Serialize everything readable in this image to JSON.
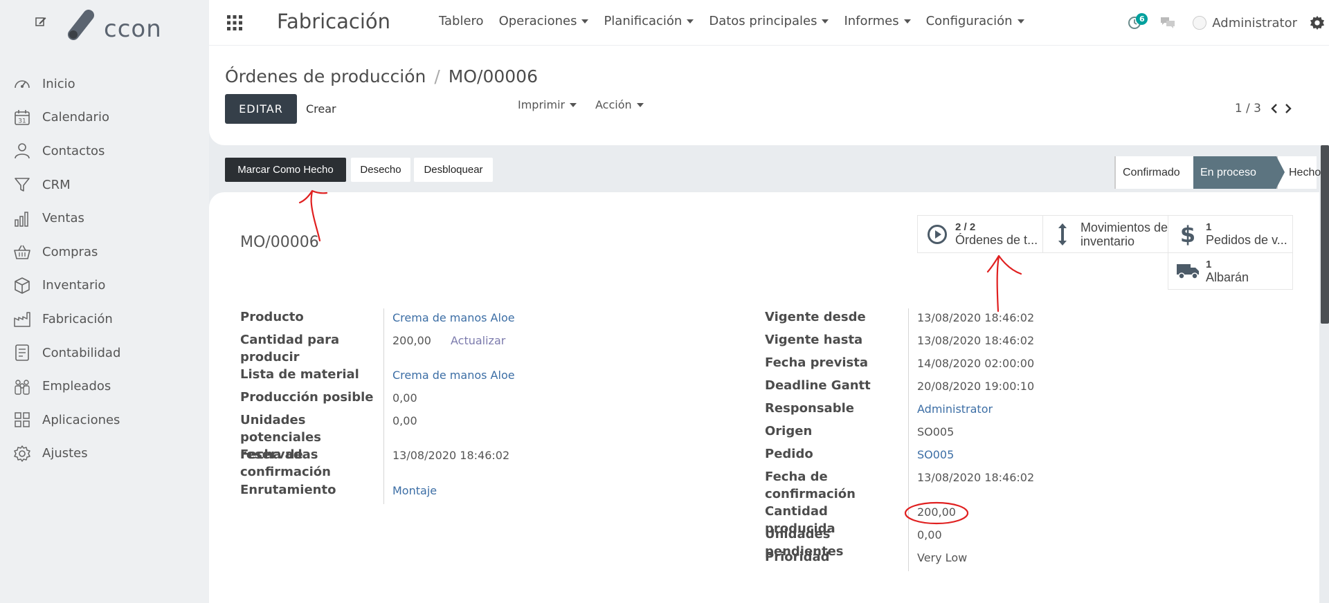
{
  "sidebar": {
    "logo_text": "ccon",
    "items": [
      {
        "label": "Inicio",
        "icon": "speedometer-icon"
      },
      {
        "label": "Calendario",
        "icon": "calendar-icon",
        "icon_text": "31"
      },
      {
        "label": "Contactos",
        "icon": "person-icon"
      },
      {
        "label": "CRM",
        "icon": "funnel-icon"
      },
      {
        "label": "Ventas",
        "icon": "bar-chart-icon"
      },
      {
        "label": "Compras",
        "icon": "basket-icon"
      },
      {
        "label": "Inventario",
        "icon": "box-icon"
      },
      {
        "label": "Fabricación",
        "icon": "factory-icon"
      },
      {
        "label": "Contabilidad",
        "icon": "ledger-icon"
      },
      {
        "label": "Empleados",
        "icon": "people-icon"
      },
      {
        "label": "Aplicaciones",
        "icon": "apps-grid-icon"
      },
      {
        "label": "Ajustes",
        "icon": "gear-icon"
      }
    ]
  },
  "topbar": {
    "app_title": "Fabricación",
    "menu": [
      {
        "label": "Tablero",
        "dropdown": false
      },
      {
        "label": "Operaciones",
        "dropdown": true
      },
      {
        "label": "Planificación",
        "dropdown": true
      },
      {
        "label": "Datos principales",
        "dropdown": true
      },
      {
        "label": "Informes",
        "dropdown": true
      },
      {
        "label": "Configuración",
        "dropdown": true
      }
    ],
    "activity_count": "6",
    "user": "Administrator"
  },
  "control_panel": {
    "breadcrumb_parent": "Órdenes de producción",
    "breadcrumb_sep": "/",
    "breadcrumb_current": "MO/00006",
    "edit_label": "EDITAR",
    "create_label": "Crear",
    "print_label": "Imprimir",
    "action_label": "Acción",
    "pager": "1 / 3"
  },
  "status_bar": {
    "buttons": [
      "Marcar Como Hecho",
      "Desecho",
      "Desbloquear"
    ],
    "stages": [
      {
        "label": "Confirmado",
        "active": false
      },
      {
        "label": "En proceso",
        "active": true
      },
      {
        "label": "Hecho",
        "active": false
      }
    ]
  },
  "form": {
    "record_name": "MO/00006",
    "smart_buttons": [
      {
        "count": "2 / 2",
        "label": "Órdenes de t...",
        "icon": "play-circle-icon"
      },
      {
        "count": "",
        "label": "Movimientos de inventario",
        "label_line1": "Movimientos de",
        "label_line2": "inventario",
        "icon": "vertical-arrows-icon"
      },
      {
        "count": "1",
        "label": "Pedidos de v...",
        "icon": "dollar-icon"
      },
      {
        "count": "1",
        "label": "Albarán",
        "icon": "truck-icon"
      }
    ],
    "left_fields": [
      {
        "label": "Producto",
        "value": "Crema de manos Aloe",
        "link": true
      },
      {
        "label": "Cantidad para producir",
        "value": "200,00",
        "action": "Actualizar"
      },
      {
        "label": "Lista de material",
        "value": "Crema de manos Aloe",
        "link": true
      },
      {
        "label": "Producción posible",
        "value": "0,00"
      },
      {
        "label": "Unidades potenciales reservadas",
        "value": "0,00"
      },
      {
        "label": "Fecha de confirmación",
        "value": "13/08/2020 18:46:02"
      },
      {
        "label": "Enrutamiento",
        "value": "Montaje",
        "link": true
      }
    ],
    "right_fields": [
      {
        "label": "Vigente desde",
        "value": "13/08/2020 18:46:02"
      },
      {
        "label": "Vigente hasta",
        "value": "13/08/2020 18:46:02"
      },
      {
        "label": "Fecha prevista",
        "value": "14/08/2020 02:00:00"
      },
      {
        "label": "Deadline Gantt",
        "value": "20/08/2020 19:00:10"
      },
      {
        "label": "Responsable",
        "value": "Administrator",
        "link": true
      },
      {
        "label": "Origen",
        "value": "SO005"
      },
      {
        "label": "Pedido",
        "value": "SO005",
        "link": true
      },
      {
        "label": "Fecha de confirmación",
        "value": "13/08/2020 18:46:02"
      },
      {
        "label": "Cantidad producida",
        "value": "200,00"
      },
      {
        "label": "Unidades pendientes",
        "value": "0,00"
      },
      {
        "label": "Prioridad",
        "value": "Very Low"
      }
    ]
  },
  "colors": {
    "primary_dark": "#353f49",
    "stage_active": "#5c7480",
    "link": "#3c6ea5",
    "badge": "#00a09d",
    "annotation": "#e02020"
  }
}
